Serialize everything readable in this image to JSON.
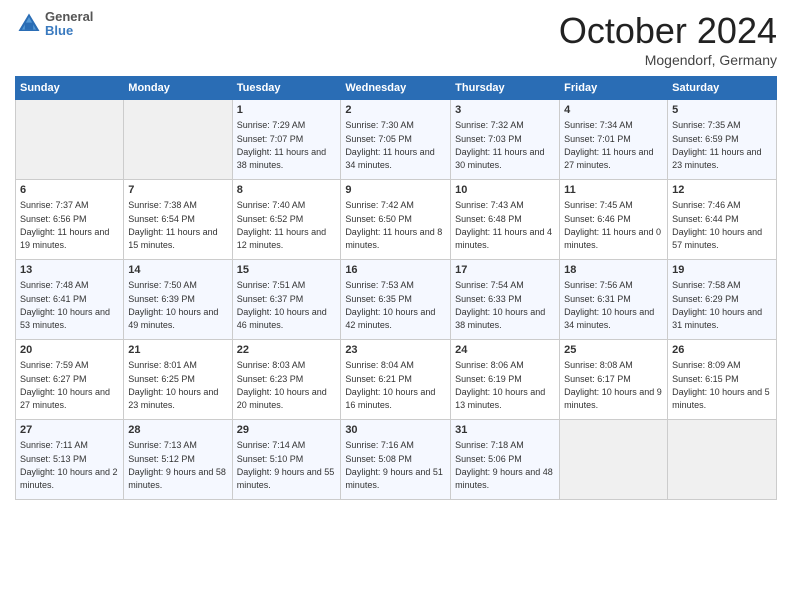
{
  "header": {
    "logo": {
      "general": "General",
      "blue": "Blue"
    },
    "title": "October 2024",
    "location": "Mogendorf, Germany"
  },
  "days_of_week": [
    "Sunday",
    "Monday",
    "Tuesday",
    "Wednesday",
    "Thursday",
    "Friday",
    "Saturday"
  ],
  "weeks": [
    [
      {
        "day": "",
        "sunrise": "",
        "sunset": "",
        "daylight": ""
      },
      {
        "day": "",
        "sunrise": "",
        "sunset": "",
        "daylight": ""
      },
      {
        "day": "1",
        "sunrise": "Sunrise: 7:29 AM",
        "sunset": "Sunset: 7:07 PM",
        "daylight": "Daylight: 11 hours and 38 minutes."
      },
      {
        "day": "2",
        "sunrise": "Sunrise: 7:30 AM",
        "sunset": "Sunset: 7:05 PM",
        "daylight": "Daylight: 11 hours and 34 minutes."
      },
      {
        "day": "3",
        "sunrise": "Sunrise: 7:32 AM",
        "sunset": "Sunset: 7:03 PM",
        "daylight": "Daylight: 11 hours and 30 minutes."
      },
      {
        "day": "4",
        "sunrise": "Sunrise: 7:34 AM",
        "sunset": "Sunset: 7:01 PM",
        "daylight": "Daylight: 11 hours and 27 minutes."
      },
      {
        "day": "5",
        "sunrise": "Sunrise: 7:35 AM",
        "sunset": "Sunset: 6:59 PM",
        "daylight": "Daylight: 11 hours and 23 minutes."
      }
    ],
    [
      {
        "day": "6",
        "sunrise": "Sunrise: 7:37 AM",
        "sunset": "Sunset: 6:56 PM",
        "daylight": "Daylight: 11 hours and 19 minutes."
      },
      {
        "day": "7",
        "sunrise": "Sunrise: 7:38 AM",
        "sunset": "Sunset: 6:54 PM",
        "daylight": "Daylight: 11 hours and 15 minutes."
      },
      {
        "day": "8",
        "sunrise": "Sunrise: 7:40 AM",
        "sunset": "Sunset: 6:52 PM",
        "daylight": "Daylight: 11 hours and 12 minutes."
      },
      {
        "day": "9",
        "sunrise": "Sunrise: 7:42 AM",
        "sunset": "Sunset: 6:50 PM",
        "daylight": "Daylight: 11 hours and 8 minutes."
      },
      {
        "day": "10",
        "sunrise": "Sunrise: 7:43 AM",
        "sunset": "Sunset: 6:48 PM",
        "daylight": "Daylight: 11 hours and 4 minutes."
      },
      {
        "day": "11",
        "sunrise": "Sunrise: 7:45 AM",
        "sunset": "Sunset: 6:46 PM",
        "daylight": "Daylight: 11 hours and 0 minutes."
      },
      {
        "day": "12",
        "sunrise": "Sunrise: 7:46 AM",
        "sunset": "Sunset: 6:44 PM",
        "daylight": "Daylight: 10 hours and 57 minutes."
      }
    ],
    [
      {
        "day": "13",
        "sunrise": "Sunrise: 7:48 AM",
        "sunset": "Sunset: 6:41 PM",
        "daylight": "Daylight: 10 hours and 53 minutes."
      },
      {
        "day": "14",
        "sunrise": "Sunrise: 7:50 AM",
        "sunset": "Sunset: 6:39 PM",
        "daylight": "Daylight: 10 hours and 49 minutes."
      },
      {
        "day": "15",
        "sunrise": "Sunrise: 7:51 AM",
        "sunset": "Sunset: 6:37 PM",
        "daylight": "Daylight: 10 hours and 46 minutes."
      },
      {
        "day": "16",
        "sunrise": "Sunrise: 7:53 AM",
        "sunset": "Sunset: 6:35 PM",
        "daylight": "Daylight: 10 hours and 42 minutes."
      },
      {
        "day": "17",
        "sunrise": "Sunrise: 7:54 AM",
        "sunset": "Sunset: 6:33 PM",
        "daylight": "Daylight: 10 hours and 38 minutes."
      },
      {
        "day": "18",
        "sunrise": "Sunrise: 7:56 AM",
        "sunset": "Sunset: 6:31 PM",
        "daylight": "Daylight: 10 hours and 34 minutes."
      },
      {
        "day": "19",
        "sunrise": "Sunrise: 7:58 AM",
        "sunset": "Sunset: 6:29 PM",
        "daylight": "Daylight: 10 hours and 31 minutes."
      }
    ],
    [
      {
        "day": "20",
        "sunrise": "Sunrise: 7:59 AM",
        "sunset": "Sunset: 6:27 PM",
        "daylight": "Daylight: 10 hours and 27 minutes."
      },
      {
        "day": "21",
        "sunrise": "Sunrise: 8:01 AM",
        "sunset": "Sunset: 6:25 PM",
        "daylight": "Daylight: 10 hours and 23 minutes."
      },
      {
        "day": "22",
        "sunrise": "Sunrise: 8:03 AM",
        "sunset": "Sunset: 6:23 PM",
        "daylight": "Daylight: 10 hours and 20 minutes."
      },
      {
        "day": "23",
        "sunrise": "Sunrise: 8:04 AM",
        "sunset": "Sunset: 6:21 PM",
        "daylight": "Daylight: 10 hours and 16 minutes."
      },
      {
        "day": "24",
        "sunrise": "Sunrise: 8:06 AM",
        "sunset": "Sunset: 6:19 PM",
        "daylight": "Daylight: 10 hours and 13 minutes."
      },
      {
        "day": "25",
        "sunrise": "Sunrise: 8:08 AM",
        "sunset": "Sunset: 6:17 PM",
        "daylight": "Daylight: 10 hours and 9 minutes."
      },
      {
        "day": "26",
        "sunrise": "Sunrise: 8:09 AM",
        "sunset": "Sunset: 6:15 PM",
        "daylight": "Daylight: 10 hours and 5 minutes."
      }
    ],
    [
      {
        "day": "27",
        "sunrise": "Sunrise: 7:11 AM",
        "sunset": "Sunset: 5:13 PM",
        "daylight": "Daylight: 10 hours and 2 minutes."
      },
      {
        "day": "28",
        "sunrise": "Sunrise: 7:13 AM",
        "sunset": "Sunset: 5:12 PM",
        "daylight": "Daylight: 9 hours and 58 minutes."
      },
      {
        "day": "29",
        "sunrise": "Sunrise: 7:14 AM",
        "sunset": "Sunset: 5:10 PM",
        "daylight": "Daylight: 9 hours and 55 minutes."
      },
      {
        "day": "30",
        "sunrise": "Sunrise: 7:16 AM",
        "sunset": "Sunset: 5:08 PM",
        "daylight": "Daylight: 9 hours and 51 minutes."
      },
      {
        "day": "31",
        "sunrise": "Sunrise: 7:18 AM",
        "sunset": "Sunset: 5:06 PM",
        "daylight": "Daylight: 9 hours and 48 minutes."
      },
      {
        "day": "",
        "sunrise": "",
        "sunset": "",
        "daylight": ""
      },
      {
        "day": "",
        "sunrise": "",
        "sunset": "",
        "daylight": ""
      }
    ]
  ]
}
